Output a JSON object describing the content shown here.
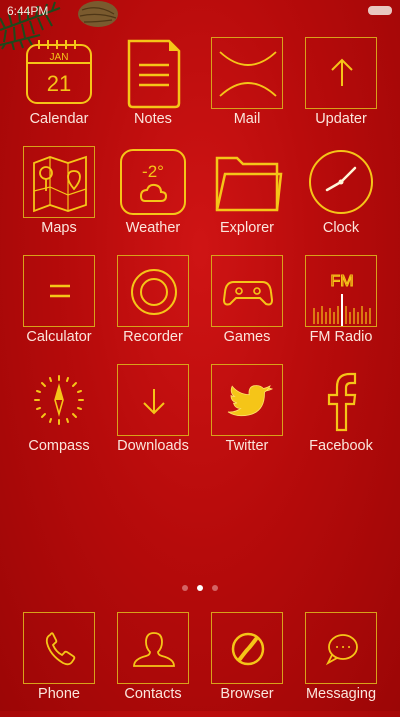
{
  "status_bar": {
    "time": "6:44PM"
  },
  "calendar": {
    "month": "JAN",
    "day": "21"
  },
  "weather": {
    "temperature": "-2°"
  },
  "fm_radio": {
    "badge": "FM"
  },
  "apps": {
    "calendar": "Calendar",
    "notes": "Notes",
    "mail": "Mail",
    "updater": "Updater",
    "maps": "Maps",
    "weather": "Weather",
    "explorer": "Explorer",
    "clock": "Clock",
    "calculator": "Calculator",
    "recorder": "Recorder",
    "games": "Games",
    "fm_radio": "FM Radio",
    "compass": "Compass",
    "downloads": "Downloads",
    "twitter": "Twitter",
    "facebook": "Facebook"
  },
  "dock": {
    "phone": "Phone",
    "contacts": "Contacts",
    "browser": "Browser",
    "messaging": "Messaging"
  },
  "page_indicator": {
    "count": 3,
    "active": 2
  },
  "theme": {
    "accent": "#f5c518",
    "background": "#b70b0b",
    "label_color": "#fbe6dc"
  }
}
